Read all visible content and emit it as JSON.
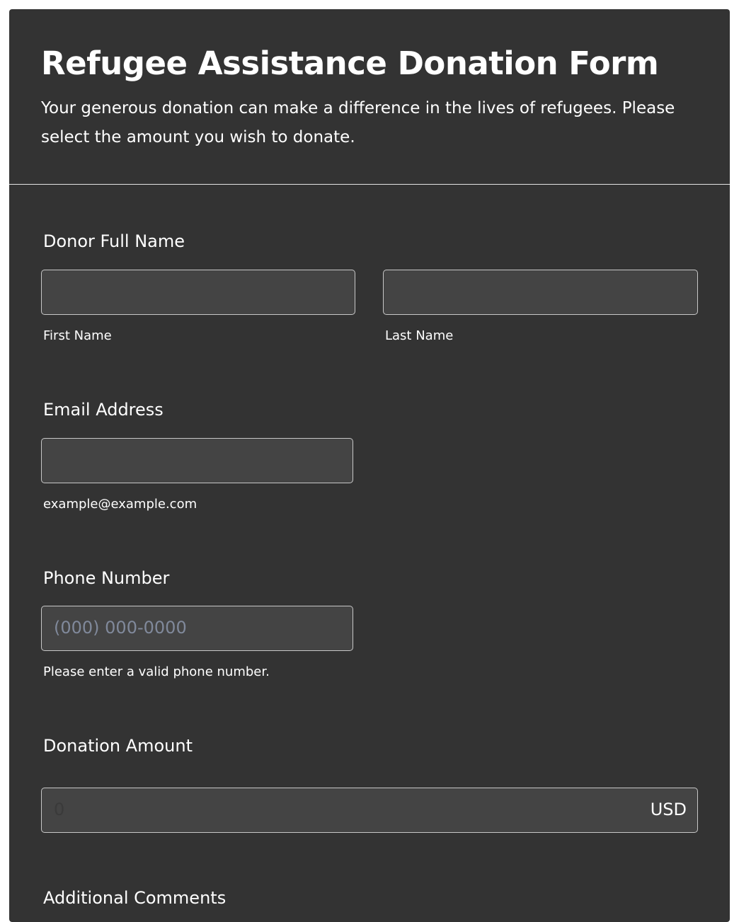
{
  "form": {
    "title": "Refugee Assistance Donation Form",
    "subtitle": "Your generous donation can make a difference in the lives of refugees. Please select the amount you wish to donate."
  },
  "name_field": {
    "label": "Donor Full Name",
    "first_sublabel": "First Name",
    "last_sublabel": "Last Name",
    "first_value": "",
    "last_value": ""
  },
  "email_field": {
    "label": "Email Address",
    "value": "",
    "sublabel": "example@example.com"
  },
  "phone_field": {
    "label": "Phone Number",
    "placeholder": "(000) 000-0000",
    "sublabel": "Please enter a valid phone number."
  },
  "amount_field": {
    "label": "Donation Amount",
    "placeholder": "0",
    "currency": "USD"
  },
  "comments_field": {
    "label": "Additional Comments"
  },
  "colors": {
    "card_background": "#333333",
    "input_background": "#444444",
    "input_border": "#c8c8c8",
    "placeholder_text": "#80899b",
    "text": "#ffffff"
  }
}
